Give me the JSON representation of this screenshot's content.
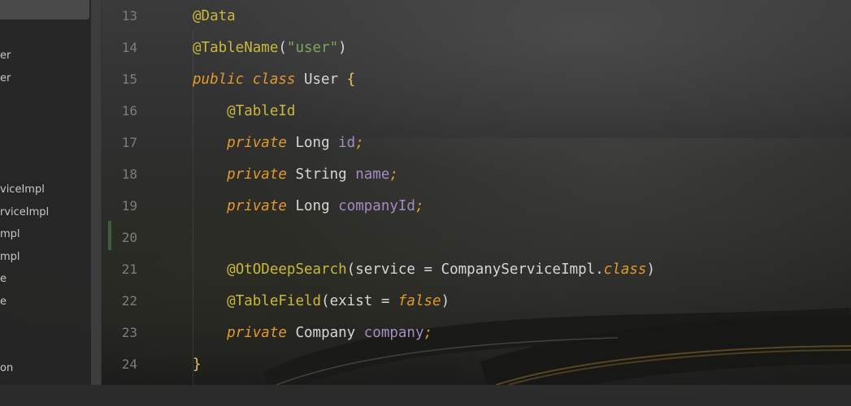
{
  "sidebar": {
    "items": [
      "er",
      "er",
      "viceImpl",
      "rviceImpl",
      "mpl",
      "mpl",
      "e",
      "e",
      "on"
    ]
  },
  "editor": {
    "lines": [
      {
        "num": "13",
        "tokens": [
          {
            "t": "@Data",
            "c": "ann"
          }
        ]
      },
      {
        "num": "14",
        "tokens": [
          {
            "t": "@TableName",
            "c": "ann"
          },
          {
            "t": "(",
            "c": "punc"
          },
          {
            "t": "\"user\"",
            "c": "str"
          },
          {
            "t": ")",
            "c": "punc"
          }
        ]
      },
      {
        "num": "15",
        "tokens": [
          {
            "t": "public",
            "c": "kw"
          },
          {
            "t": " ",
            "c": "plain"
          },
          {
            "t": "class",
            "c": "kw"
          },
          {
            "t": " User ",
            "c": "plain"
          },
          {
            "t": "{",
            "c": "brace"
          }
        ]
      },
      {
        "num": "16",
        "tokens": [
          {
            "t": "    ",
            "c": "plain"
          },
          {
            "t": "@TableId",
            "c": "ann"
          }
        ]
      },
      {
        "num": "17",
        "tokens": [
          {
            "t": "    ",
            "c": "plain"
          },
          {
            "t": "private",
            "c": "kw"
          },
          {
            "t": " Long ",
            "c": "plain"
          },
          {
            "t": "id",
            "c": "fld"
          },
          {
            "t": ";",
            "c": "kw"
          }
        ]
      },
      {
        "num": "18",
        "tokens": [
          {
            "t": "    ",
            "c": "plain"
          },
          {
            "t": "private",
            "c": "kw"
          },
          {
            "t": " String ",
            "c": "plain"
          },
          {
            "t": "name",
            "c": "fld"
          },
          {
            "t": ";",
            "c": "kw"
          }
        ]
      },
      {
        "num": "19",
        "tokens": [
          {
            "t": "    ",
            "c": "plain"
          },
          {
            "t": "private",
            "c": "kw"
          },
          {
            "t": " Long ",
            "c": "plain"
          },
          {
            "t": "companyId",
            "c": "fld"
          },
          {
            "t": ";",
            "c": "kw"
          }
        ]
      },
      {
        "num": "20",
        "tokens": []
      },
      {
        "num": "21",
        "tokens": [
          {
            "t": "    ",
            "c": "plain"
          },
          {
            "t": "@OtODeepSearch",
            "c": "ann"
          },
          {
            "t": "(service = CompanyServiceImpl.",
            "c": "plain"
          },
          {
            "t": "class",
            "c": "kw"
          },
          {
            "t": ")",
            "c": "plain"
          }
        ]
      },
      {
        "num": "22",
        "tokens": [
          {
            "t": "    ",
            "c": "plain"
          },
          {
            "t": "@TableField",
            "c": "ann"
          },
          {
            "t": "(exist = ",
            "c": "plain"
          },
          {
            "t": "false",
            "c": "kw"
          },
          {
            "t": ")",
            "c": "plain"
          }
        ]
      },
      {
        "num": "23",
        "tokens": [
          {
            "t": "    ",
            "c": "plain"
          },
          {
            "t": "private",
            "c": "kw"
          },
          {
            "t": " Company ",
            "c": "plain"
          },
          {
            "t": "company",
            "c": "fld"
          },
          {
            "t": ";",
            "c": "kw"
          }
        ]
      },
      {
        "num": "24",
        "tokens": [
          {
            "t": "}",
            "c": "brace"
          }
        ]
      }
    ]
  },
  "colors": {
    "annotation": "#c9b93b",
    "keyword": "#e39a2d",
    "string": "#7fa560",
    "field": "#a38cc2",
    "text": "#d6d6d6",
    "line_number": "#7d7d7d"
  }
}
